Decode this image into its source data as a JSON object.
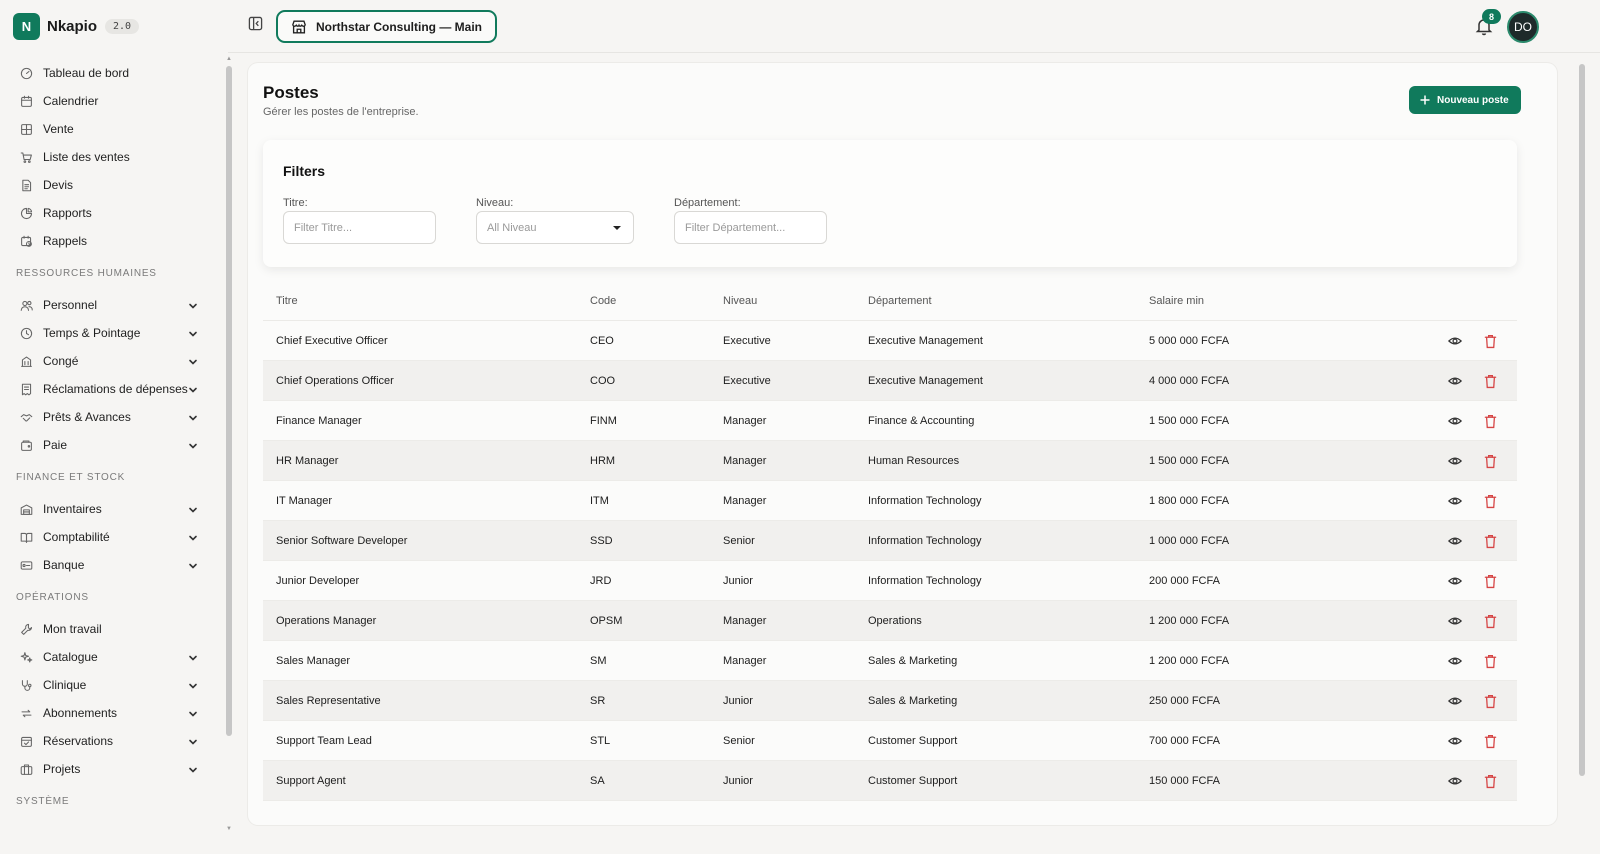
{
  "brand": {
    "logo_letter": "N",
    "name": "Nkapio",
    "version": "2.0"
  },
  "sidebar": {
    "main_items": [
      {
        "label": "Tableau de bord",
        "icon": "gauge-icon"
      },
      {
        "label": "Calendrier",
        "icon": "calendar-icon"
      },
      {
        "label": "Vente",
        "icon": "grid-icon"
      },
      {
        "label": "Liste des ventes",
        "icon": "cart-icon"
      },
      {
        "label": "Devis",
        "icon": "document-icon"
      },
      {
        "label": "Rapports",
        "icon": "pie-chart-icon"
      },
      {
        "label": "Rappels",
        "icon": "calendar-clock-icon"
      }
    ],
    "sections": [
      {
        "title": "RESSOURCES HUMAINES",
        "items": [
          {
            "label": "Personnel",
            "icon": "users-icon"
          },
          {
            "label": "Temps & Pointage",
            "icon": "clock-icon"
          },
          {
            "label": "Congé",
            "icon": "building-icon"
          },
          {
            "label": "Réclamations de dépenses",
            "icon": "receipt-icon"
          },
          {
            "label": "Prêts & Avances",
            "icon": "handshake-icon"
          },
          {
            "label": "Paie",
            "icon": "wallet-icon"
          }
        ]
      },
      {
        "title": "FINANCE ET STOCK",
        "items": [
          {
            "label": "Inventaires",
            "icon": "inventory-icon"
          },
          {
            "label": "Comptabilité",
            "icon": "book-icon"
          },
          {
            "label": "Banque",
            "icon": "bank-card-icon"
          }
        ]
      },
      {
        "title": "OPÉRATIONS",
        "items": [
          {
            "label": "Mon travail",
            "icon": "wrench-icon",
            "expandable": false
          },
          {
            "label": "Catalogue",
            "icon": "sparkles-icon"
          },
          {
            "label": "Clinique",
            "icon": "stethoscope-icon"
          },
          {
            "label": "Abonnements",
            "icon": "repeat-icon"
          },
          {
            "label": "Réservations",
            "icon": "calendar-check-icon"
          },
          {
            "label": "Projets",
            "icon": "briefcase-icon"
          }
        ]
      }
    ],
    "trailing_section": "SYSTÈME"
  },
  "topbar": {
    "company": "Northstar Consulting — Main",
    "notification_count": "8",
    "avatar_initials": "DO"
  },
  "page": {
    "title": "Postes",
    "subtitle": "Gérer les postes de l'entreprise.",
    "new_button": "Nouveau poste"
  },
  "filters": {
    "title": "Filters",
    "titre_label": "Titre:",
    "titre_placeholder": "Filter Titre...",
    "niveau_label": "Niveau:",
    "niveau_value": "All Niveau",
    "dept_label": "Département:",
    "dept_placeholder": "Filter Département..."
  },
  "table": {
    "columns": [
      "Titre",
      "Code",
      "Niveau",
      "Département",
      "Salaire min"
    ],
    "rows": [
      {
        "title": "Chief Executive Officer",
        "code": "CEO",
        "level": "Executive",
        "dept": "Executive Management",
        "salary": "5 000 000 FCFA"
      },
      {
        "title": "Chief Operations Officer",
        "code": "COO",
        "level": "Executive",
        "dept": "Executive Management",
        "salary": "4 000 000 FCFA"
      },
      {
        "title": "Finance Manager",
        "code": "FINM",
        "level": "Manager",
        "dept": "Finance & Accounting",
        "salary": "1 500 000 FCFA"
      },
      {
        "title": "HR Manager",
        "code": "HRM",
        "level": "Manager",
        "dept": "Human Resources",
        "salary": "1 500 000 FCFA"
      },
      {
        "title": "IT Manager",
        "code": "ITM",
        "level": "Manager",
        "dept": "Information Technology",
        "salary": "1 800 000 FCFA"
      },
      {
        "title": "Senior Software Developer",
        "code": "SSD",
        "level": "Senior",
        "dept": "Information Technology",
        "salary": "1 000 000 FCFA"
      },
      {
        "title": "Junior Developer",
        "code": "JRD",
        "level": "Junior",
        "dept": "Information Technology",
        "salary": "200 000 FCFA"
      },
      {
        "title": "Operations Manager",
        "code": "OPSM",
        "level": "Manager",
        "dept": "Operations",
        "salary": "1 200 000 FCFA"
      },
      {
        "title": "Sales Manager",
        "code": "SM",
        "level": "Manager",
        "dept": "Sales & Marketing",
        "salary": "1 200 000 FCFA"
      },
      {
        "title": "Sales Representative",
        "code": "SR",
        "level": "Junior",
        "dept": "Sales & Marketing",
        "salary": "250 000 FCFA"
      },
      {
        "title": "Support Team Lead",
        "code": "STL",
        "level": "Senior",
        "dept": "Customer Support",
        "salary": "700 000 FCFA"
      },
      {
        "title": "Support Agent",
        "code": "SA",
        "level": "Junior",
        "dept": "Customer Support",
        "salary": "150 000 FCFA"
      }
    ]
  },
  "colors": {
    "accent": "#107a5c",
    "danger": "#d64545",
    "background": "#f6f5f3"
  }
}
